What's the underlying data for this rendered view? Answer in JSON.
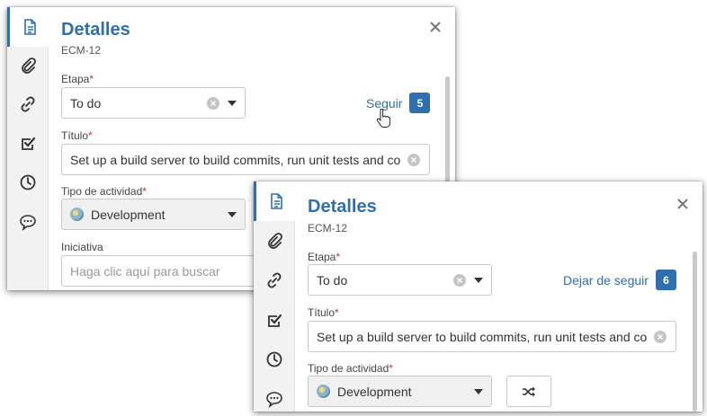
{
  "panel_a": {
    "title": "Detalles",
    "key": "ECM-12",
    "stage_label": "Etapa",
    "stage_value": "To do",
    "follow_label": "Seguir",
    "follow_count": "5",
    "title_label": "Título",
    "title_value": "Set up a build server to build commits, run unit tests and conf",
    "type_label": "Tipo de actividad",
    "type_value": "Development",
    "initiative_label": "Iniciativa",
    "initiative_placeholder": "Haga clic aquí para buscar"
  },
  "panel_b": {
    "title": "Detalles",
    "key": "ECM-12",
    "stage_label": "Etapa",
    "stage_value": "To do",
    "follow_label": "Dejar de seguir",
    "follow_count": "6",
    "title_label": "Título",
    "title_value": "Set up a build server to build commits, run unit tests and conf",
    "type_label": "Tipo de actividad",
    "type_value": "Development"
  },
  "required_marker": "*",
  "rail_icons": [
    "document-icon",
    "paperclip-icon",
    "link-icon",
    "checkbox-icon",
    "clock-icon",
    "comment-icon"
  ],
  "colors": {
    "accent": "#2f6fb0",
    "required": "#c0392b"
  }
}
